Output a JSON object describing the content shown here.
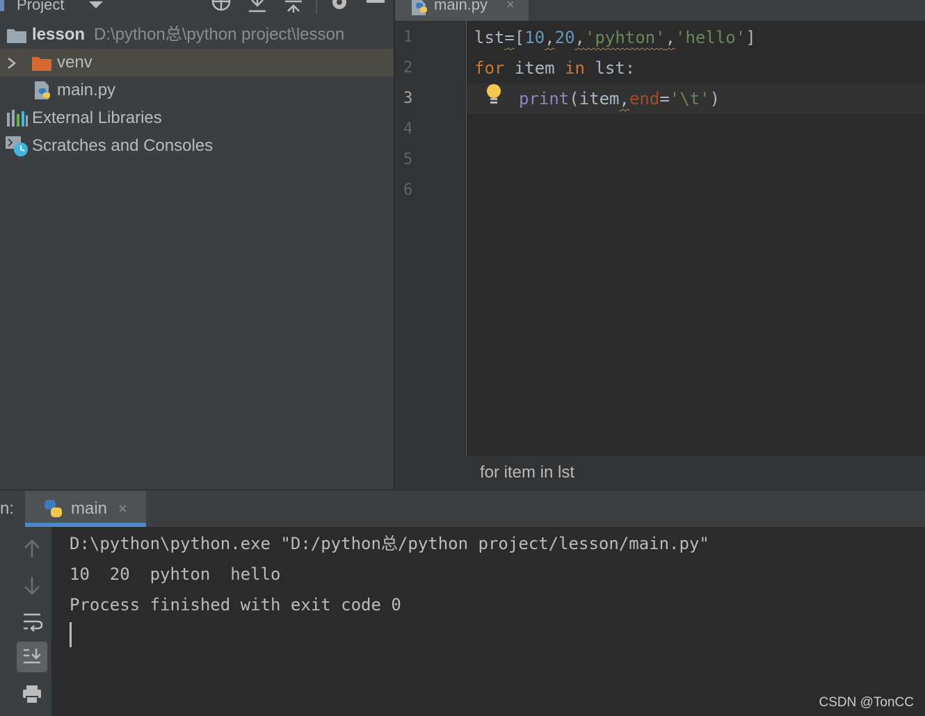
{
  "project": {
    "title": "Project",
    "tree": [
      {
        "label": "lesson",
        "path": "D:\\python总\\python project\\lesson"
      },
      {
        "label": "venv"
      },
      {
        "label": "main.py"
      },
      {
        "label": "External Libraries"
      },
      {
        "label": "Scratches and Consoles"
      }
    ]
  },
  "editor": {
    "tab_label": "main.py",
    "tab_close": "×",
    "line_numbers": [
      "1",
      "2",
      "3",
      "4",
      "5",
      "6"
    ],
    "current_line": "3",
    "code": {
      "l1": [
        "lst",
        "=",
        "[",
        "10",
        ",",
        "20",
        ",",
        "'pyhton'",
        ",",
        "'hello'",
        "]"
      ],
      "l2": [
        "for",
        " item ",
        "in",
        " lst:"
      ],
      "l3": [
        "print",
        "(item",
        ",",
        "end",
        "=",
        "'\\t'",
        ")"
      ]
    },
    "breadcrumb": "for item in lst"
  },
  "run": {
    "label": "n:",
    "tab_label": "main",
    "tab_close": "×",
    "console": [
      "D:\\python\\python.exe \"D:/python总/python project/lesson/main.py\"",
      "10  20  pyhton  hello",
      "Process finished with exit code 0"
    ]
  },
  "icons": [
    "locate-icon",
    "collapse-all-icon",
    "expand-all-icon",
    "gear-icon",
    "minimize-icon",
    "python-file-icon",
    "folder-icon",
    "library-icon",
    "scratches-icon",
    "lightbulb-icon",
    "arrow-up-icon",
    "arrow-down-icon",
    "soft-wrap-icon",
    "scroll-to-end-icon",
    "print-icon"
  ],
  "watermark": "CSDN @TonCC",
  "colors": {
    "keyword": "#cc7832",
    "number": "#6897bb",
    "string": "#6a8759",
    "builtin": "#8888c6",
    "param": "#aa4926",
    "run_tab_underline": "#4a88c7"
  }
}
